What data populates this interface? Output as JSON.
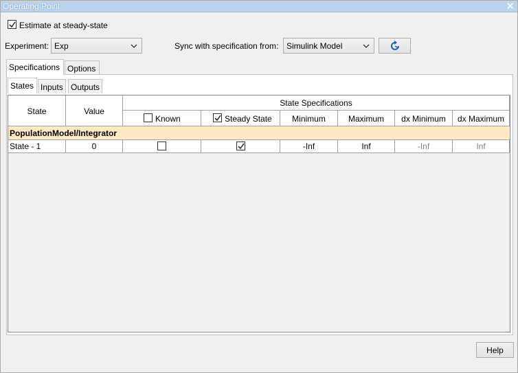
{
  "window": {
    "title": "Operating Point",
    "close_glyph": "✕"
  },
  "estimate": {
    "label": "Estimate at steady-state",
    "checked": true
  },
  "experiment": {
    "label": "Experiment:",
    "value": "Exp"
  },
  "sync": {
    "label": "Sync with specification from:",
    "value": "Simulink Model",
    "refresh_icon": "refresh-icon"
  },
  "tabs": [
    {
      "label": "Specifications",
      "active": true
    },
    {
      "label": "Options",
      "active": false
    }
  ],
  "subtabs": [
    {
      "label": "States",
      "active": true
    },
    {
      "label": "Inputs",
      "active": false
    },
    {
      "label": "Outputs",
      "active": false
    }
  ],
  "table": {
    "headers": {
      "state": "State",
      "value": "Value",
      "group": "State Specifications",
      "known": "Known",
      "steady": "Steady State",
      "min": "Minimum",
      "max": "Maximum",
      "dxmin": "dx Minimum",
      "dxmax": "dx Maximum"
    },
    "header_known_checked": false,
    "header_steady_checked": true,
    "group_label": "PopulationModel/Integrator",
    "rows": [
      {
        "state": "State - 1",
        "value": "0",
        "known": false,
        "steady": true,
        "min": "-Inf",
        "max": "Inf",
        "dxmin": "-Inf",
        "dxmax": "Inf"
      }
    ]
  },
  "help": {
    "label": "Help"
  }
}
